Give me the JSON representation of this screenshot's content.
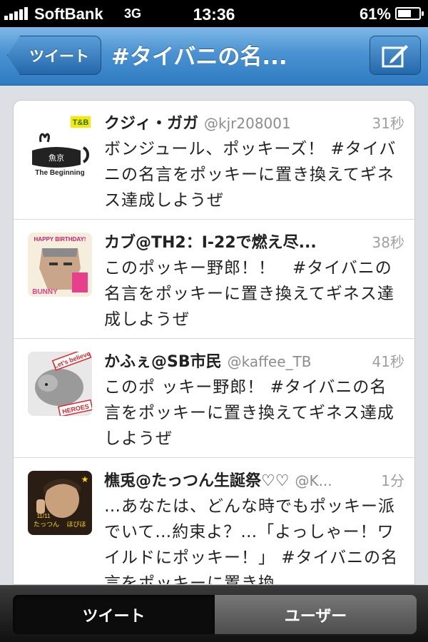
{
  "status_bar": {
    "carrier": "SoftBank",
    "network": "3G",
    "time": "13:36",
    "battery": "61%",
    "battery_level": 0.61,
    "signal_bars": 5
  },
  "nav": {
    "back_label": "ツイート",
    "title": "#タイバニの名...",
    "compose_icon": "compose-icon"
  },
  "tweets": [
    {
      "name": "クジィ・ガガ",
      "handle": "@kjr208001",
      "time": "31秒",
      "text": "ボンジュール、ポッキーズ！ #タイバニの名言をポッキーに置き換えてギネス達成しようぜ",
      "avatar_texts": [
        "T&B",
        "魚京",
        "The Beginning"
      ]
    },
    {
      "name": "カブ@TH2：I-22で燃え尽...",
      "handle": "",
      "time": "38秒",
      "text": "このポッキー野郎！！　#タイバニの名言をポッキーに置き換えてギネス達成しようぜ",
      "avatar_texts": [
        "HAPPY BIRTHDAY!",
        "BUNNY"
      ]
    },
    {
      "name": "かふぇ@SB市民",
      "handle": "@kaffee_TB",
      "time": "41秒",
      "text": "このポ ッキー野郎！ #タイバニの名言をポッキーに置き換えてギネス達成しようぜ",
      "avatar_texts": [
        "Let's believe",
        "HEROES"
      ]
    },
    {
      "name": "樵兎@たっつん生誕祭♡♡",
      "handle": "@K...",
      "time": "1分",
      "text": "…あなたは、どんな時でもポッキー派でいて…約束よ？…「よっしゃー！ワイルドにポッキー！」 #タイバニの名言をポッキーに置き換",
      "avatar_texts": [
        "11/11",
        "たっつん",
        "ほぴほ"
      ]
    }
  ],
  "tab_bar": {
    "tabs": [
      {
        "label": "ツイート",
        "selected": true
      },
      {
        "label": "ユーザー",
        "selected": false
      }
    ]
  }
}
